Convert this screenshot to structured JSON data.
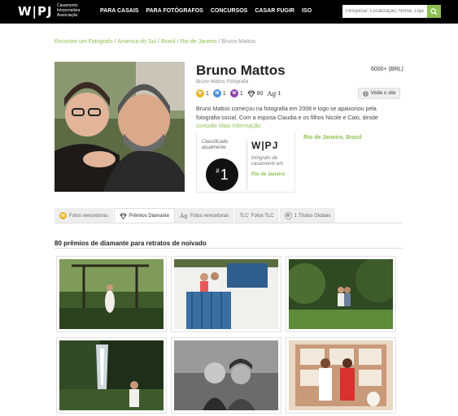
{
  "header": {
    "logo": "W|PJ",
    "logo_subtitle": "Casamento fotojornalista Associação",
    "nav": [
      "PARA CASAIS",
      "PARA FOTÓGRAFOS",
      "CONCURSOS",
      "CASAR FUGIR",
      "ISO"
    ],
    "search_placeholder": "Pesquisar: Localização, Nome, Loja"
  },
  "breadcrumb": [
    "Encontre um Fotógrafo",
    "América do Sul",
    "Brasil",
    "Rio de Janeiro",
    "Bruno Mattos"
  ],
  "profile": {
    "name": "Bruno Mattos",
    "studio": "Bruno Mattos Fotografia",
    "price": "6000+ (BRL)",
    "website_button": "Visite o site",
    "badges": [
      {
        "icon": "gold-award-icon",
        "letter": "W",
        "count": "1",
        "color": "#e6b422"
      },
      {
        "icon": "silver-award-icon",
        "letter": "W",
        "count": "1",
        "color": "#4a90d9"
      },
      {
        "icon": "purple-award-icon",
        "letter": "W",
        "count": "1",
        "color": "#8e44ad"
      },
      {
        "icon": "diamond-icon",
        "count": "80"
      },
      {
        "icon": "ag-icon",
        "count": "1"
      }
    ],
    "bio": "Bruno Mattos começou na fotografia em 2008 e logo se apaixonou pela fotografia social. Com a esposa Claudia e os filhos Nicole e Caio, desde",
    "bio_more": [
      "consulte",
      "Mais informação"
    ],
    "location": "Rio de Janeiro, Brasil"
  },
  "ranking": {
    "label": "Classificado atualmente",
    "number": "1",
    "logo": "W|PJ",
    "description": "fotógrafo de casamento em",
    "region": "Rio de Janeiro"
  },
  "tabs": [
    {
      "icon": "award-icon",
      "label": "Fotos vencedoras",
      "active": false
    },
    {
      "icon": "diamond-icon",
      "label": "Prêmios Diamante",
      "active": true
    },
    {
      "icon": "ag-icon",
      "label": "Fotos vencedoras",
      "active": false
    },
    {
      "icon": "tlc-icon",
      "label": "Fotos TLC",
      "active": false
    },
    {
      "icon": "title-icon",
      "label": "1 Títulos Globais",
      "active": false
    }
  ],
  "section_title": "80 prêmios de diamante para retratos de noivado",
  "colors": {
    "accent": "#8cc152",
    "nav_bg": "#000000"
  }
}
